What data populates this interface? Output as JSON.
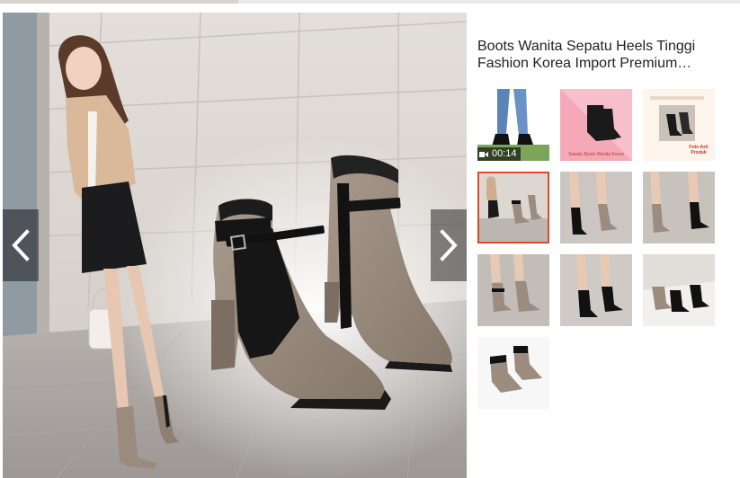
{
  "product": {
    "title": "Boots Wanita Sepatu Heels Tinggi Fashion Korea Import Premium…"
  },
  "gallery": {
    "video_duration": "00:14",
    "active_index": 4,
    "thumbnail_count": 10,
    "thumb3_text": "Foto Asli Produk",
    "thumb2_caption": "Sepatu Boots Wanita Korea"
  },
  "icons": {
    "prev": "chevron-left-icon",
    "next": "chevron-right-icon",
    "video": "video-camera-icon"
  },
  "colors": {
    "active_border": "#e0482a",
    "nav_overlay": "rgba(0,0,0,0.45)",
    "suede": "#9b8c7f",
    "black": "#1a1a1a"
  }
}
